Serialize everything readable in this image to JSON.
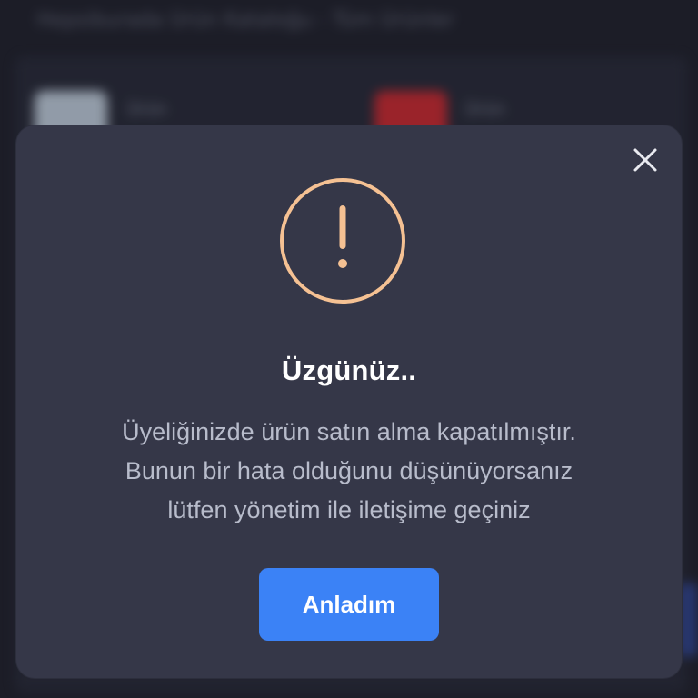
{
  "background": {
    "top_text": "Hepsiburada Ürün Kataloğu - Tüm Ürünler",
    "item_1_label": "Ürün",
    "item_2_label": "Ürün"
  },
  "dialog": {
    "close_icon": "close-icon",
    "status_icon": "warning-circle-icon",
    "accent_color": "#f5c193",
    "title": "Üzgünüz..",
    "message_lines": [
      "Üyeliğinizde ürün satın alma kapatılmıştır.",
      "Bunun bir hata olduğunu düşünüyorsanız",
      "lütfen yönetim ile iletişime geçiniz"
    ],
    "confirm_label": "Anladım",
    "confirm_color": "#3b82f6"
  }
}
